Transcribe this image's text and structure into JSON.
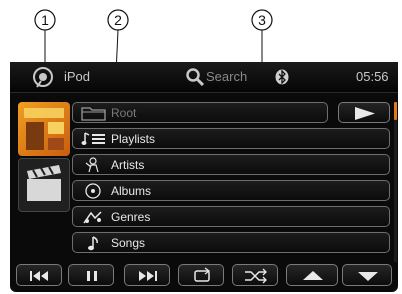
{
  "callouts": [
    "1",
    "2",
    "3"
  ],
  "status": {
    "source": "iPod",
    "search_label": "Search",
    "time": "05:56"
  },
  "browser": {
    "root_label": "Root",
    "items": [
      {
        "label": "Playlists",
        "icon": "playlist-icon"
      },
      {
        "label": "Artists",
        "icon": "artist-icon"
      },
      {
        "label": "Albums",
        "icon": "album-icon"
      },
      {
        "label": "Genres",
        "icon": "genre-icon"
      },
      {
        "label": "Songs",
        "icon": "song-icon"
      }
    ]
  },
  "controls": [
    "previous-icon",
    "pause-icon",
    "next-icon",
    "repeat-icon",
    "shuffle-icon",
    "scroll-up-icon",
    "scroll-down-icon"
  ],
  "colors": {
    "accent": "#e07b18",
    "screen": "#0a0a0a",
    "text": "#e8e8e8"
  }
}
